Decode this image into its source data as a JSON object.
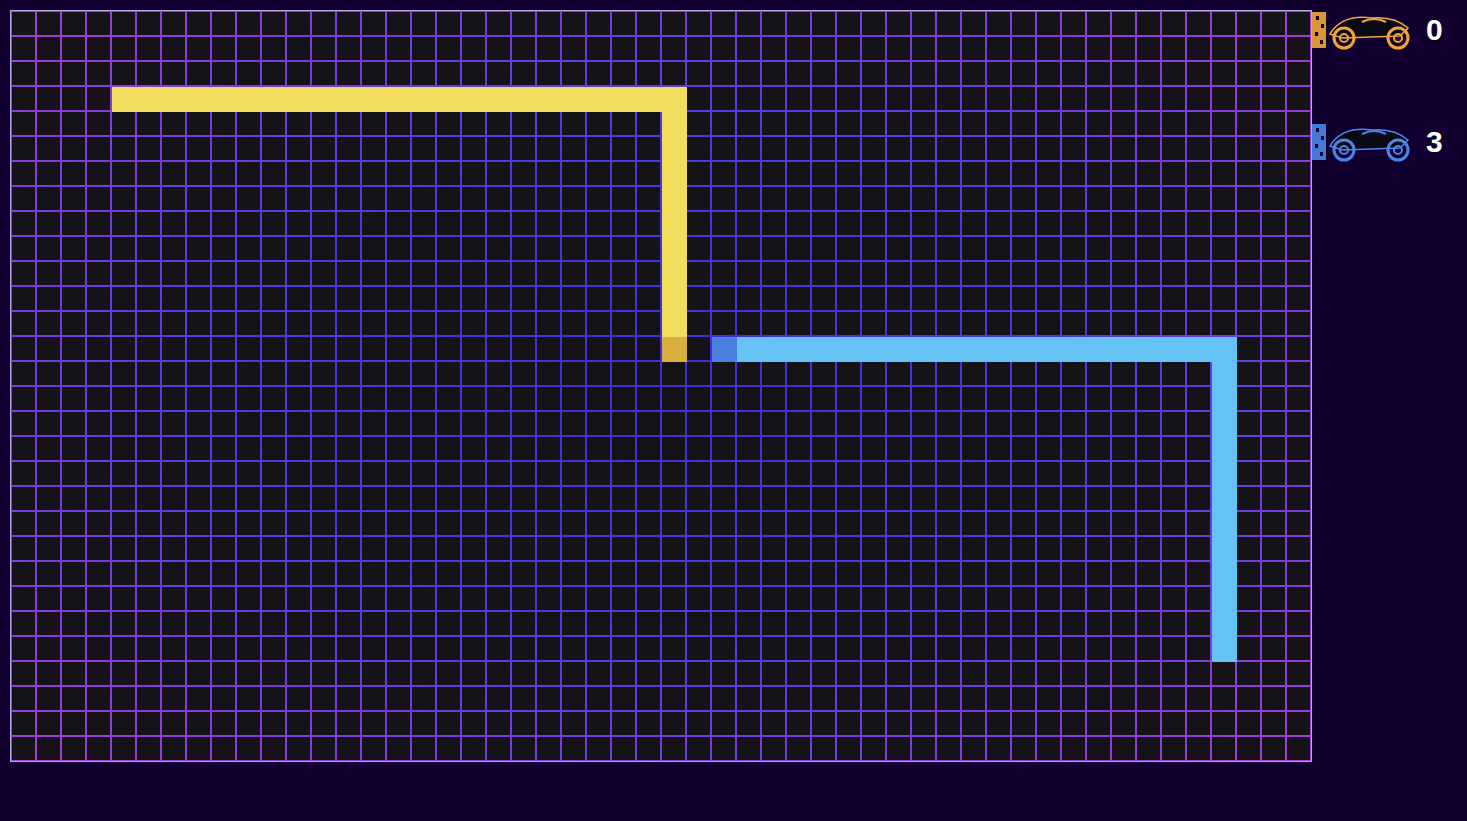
{
  "scoreboard": [
    {
      "score": "0",
      "color": "#f0a53a"
    },
    {
      "score": "3",
      "color": "#4a86e8"
    }
  ],
  "trails": [
    {
      "color": "#f2dc5d",
      "head_color": "#d9b040",
      "points": [
        [
          4,
          3
        ],
        [
          26,
          3
        ],
        [
          26,
          13
        ]
      ]
    },
    {
      "color": "#64c2f5",
      "head_color": "#4a7fe0",
      "points": [
        [
          48,
          25
        ],
        [
          48,
          13
        ],
        [
          28,
          13
        ]
      ]
    }
  ]
}
